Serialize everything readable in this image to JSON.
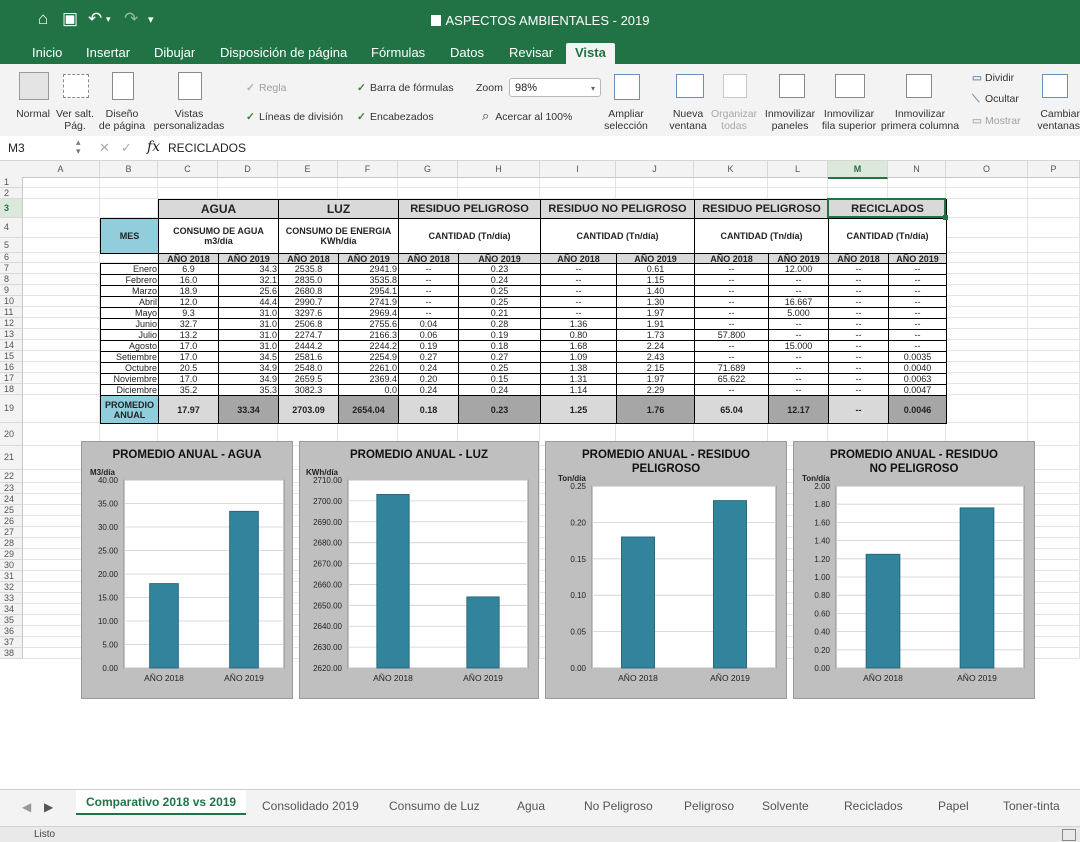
{
  "window": {
    "title": "ASPECTOS AMBIENTALES - 2019"
  },
  "ribbon_tabs": [
    "Inicio",
    "Insertar",
    "Dibujar",
    "Disposición de página",
    "Fórmulas",
    "Datos",
    "Revisar",
    "Vista"
  ],
  "active_tab": "Vista",
  "ribbon": {
    "normal": "Normal",
    "ver_salt_1": "Ver salt.",
    "ver_salt_2": "Pág.",
    "diseno_1": "Diseño",
    "diseno_2": "de página",
    "vistas_1": "Vistas",
    "vistas_2": "personalizadas",
    "regla": "Regla",
    "lineas": "Líneas de división",
    "barra": "Barra de fórmulas",
    "encabezados": "Encabezados",
    "zoom_label": "Zoom",
    "zoom_value": "98%",
    "acercar": "Acercar al 100%",
    "ampliar_1": "Ampliar",
    "ampliar_2": "selección",
    "nueva_1": "Nueva",
    "nueva_2": "ventana",
    "organizar_1": "Organizar",
    "organizar_2": "todas",
    "inm_paneles_1": "Inmovilizar",
    "inm_paneles_2": "paneles",
    "inm_fila_1": "Inmovilizar",
    "inm_fila_2": "fila superior",
    "inm_col_1": "Inmovilizar",
    "inm_col_2": "primera columna",
    "dividir": "Dividir",
    "ocultar": "Ocultar",
    "mostrar": "Mostrar",
    "cambiar_1": "Cambiar",
    "cambiar_2": "ventanas"
  },
  "formula_bar": {
    "cell_ref": "M3",
    "fx": "fx",
    "content": "RECICLADOS"
  },
  "columns": [
    "A",
    "B",
    "C",
    "D",
    "E",
    "F",
    "G",
    "H",
    "I",
    "J",
    "K",
    "L",
    "M",
    "N",
    "O",
    "P"
  ],
  "rows": [
    "1",
    "2",
    "3",
    "4",
    "5",
    "6",
    "7",
    "8",
    "9",
    "10",
    "11",
    "12",
    "13",
    "14",
    "15",
    "16",
    "17",
    "18",
    "19",
    "20",
    "21",
    "22",
    "23",
    "24",
    "25",
    "26",
    "27",
    "28",
    "29",
    "30",
    "31",
    "32",
    "33",
    "34",
    "35",
    "36",
    "37",
    "38"
  ],
  "table": {
    "sections": [
      "AGUA",
      "LUZ",
      "RESIDUO PELIGROSO",
      "RESIDUO NO PELIGROSO",
      "RESIDUO PELIGROSO",
      "RECICLADOS"
    ],
    "mes": "MES",
    "subheaders": [
      "CONSUMO DE AGUA m3/día",
      "CONSUMO DE ENERGIA KWh/día",
      "CANTIDAD (Tn/día)",
      "CANTIDAD (Tn/día)",
      "CANTIDAD (Tn/día)",
      "CANTIDAD (Tn/día)"
    ],
    "years": [
      "AÑO 2018",
      "AÑO 2019"
    ],
    "months": [
      "Enero",
      "Febrero",
      "Marzo",
      "Abril",
      "Mayo",
      "Junio",
      "Julio",
      "Agosto",
      "Setiembre",
      "Octubre",
      "Noviembre",
      "Diciembre"
    ],
    "data": [
      [
        "6.9",
        "34.3",
        "2535.8",
        "2941.9",
        "--",
        "0.23",
        "--",
        "0.61",
        "--",
        "12.000",
        "--",
        "--"
      ],
      [
        "16.0",
        "32.1",
        "2835.0",
        "3535.8",
        "--",
        "0.24",
        "--",
        "1.15",
        "--",
        "--",
        "--",
        "--"
      ],
      [
        "18.9",
        "25.6",
        "2680.8",
        "2954.1",
        "--",
        "0.25",
        "--",
        "1.40",
        "--",
        "--",
        "--",
        "--"
      ],
      [
        "12.0",
        "44.4",
        "2990.7",
        "2741.9",
        "--",
        "0.25",
        "--",
        "1.30",
        "--",
        "16.667",
        "--",
        "--"
      ],
      [
        "9.3",
        "31.0",
        "3297.6",
        "2969.4",
        "--",
        "0.21",
        "--",
        "1.97",
        "--",
        "5.000",
        "--",
        "--"
      ],
      [
        "32.7",
        "31.0",
        "2506.8",
        "2755.6",
        "0.04",
        "0.28",
        "1.36",
        "1.91",
        "--",
        "--",
        "--",
        "--"
      ],
      [
        "13.2",
        "31.0",
        "2274.7",
        "2166.3",
        "0.06",
        "0.19",
        "0.80",
        "1.73",
        "57.800",
        "--",
        "--",
        "--"
      ],
      [
        "17.0",
        "31.0",
        "2444.2",
        "2244.2",
        "0.19",
        "0.18",
        "1.68",
        "2.24",
        "--",
        "15.000",
        "--",
        "--"
      ],
      [
        "17.0",
        "34.5",
        "2581.6",
        "2254.9",
        "0.27",
        "0.27",
        "1.09",
        "2.43",
        "--",
        "--",
        "--",
        "0.0035"
      ],
      [
        "20.5",
        "34.9",
        "2548.0",
        "2261.0",
        "0.24",
        "0.25",
        "1.38",
        "2.15",
        "71.689",
        "--",
        "--",
        "0.0040"
      ],
      [
        "17.0",
        "34.9",
        "2659.5",
        "2369.4",
        "0.20",
        "0.15",
        "1.31",
        "1.97",
        "65.622",
        "--",
        "--",
        "0.0063"
      ],
      [
        "35.2",
        "35.3",
        "3082.3",
        "0.0",
        "0.24",
        "0.24",
        "1.14",
        "2.29",
        "--",
        "--",
        "--",
        "0.0047"
      ]
    ],
    "promedio_label": "PROMEDIO ANUAL",
    "promedio": [
      "17.97",
      "33.34",
      "2703.09",
      "2654.04",
      "0.18",
      "0.23",
      "1.25",
      "1.76",
      "65.04",
      "12.17",
      "--",
      "0.0046"
    ]
  },
  "chart_data": [
    {
      "type": "bar",
      "title": "PROMEDIO ANUAL - AGUA",
      "ylabel": "M3/día",
      "categories": [
        "AÑO 2018",
        "AÑO 2019"
      ],
      "values": [
        17.97,
        33.34
      ],
      "ylim": [
        0,
        40
      ],
      "yticks": [
        "0.00",
        "5.00",
        "10.00",
        "15.00",
        "20.00",
        "25.00",
        "30.00",
        "35.00",
        "40.00"
      ],
      "color": "#31849b",
      "grid": true
    },
    {
      "type": "bar",
      "title": "PROMEDIO ANUAL - LUZ",
      "ylabel": "KWh/día",
      "categories": [
        "AÑO 2018",
        "AÑO 2019"
      ],
      "values": [
        2703.09,
        2654.04
      ],
      "ylim": [
        2620,
        2710
      ],
      "yticks": [
        "2620.00",
        "2630.00",
        "2640.00",
        "2650.00",
        "2660.00",
        "2670.00",
        "2680.00",
        "2690.00",
        "2700.00",
        "2710.00"
      ],
      "color": "#31849b",
      "grid": true
    },
    {
      "type": "bar",
      "title": "PROMEDIO ANUAL - RESIDUO PELIGROSO",
      "ylabel": "Ton/día",
      "categories": [
        "AÑO 2018",
        "AÑO 2019"
      ],
      "values": [
        0.18,
        0.23
      ],
      "ylim": [
        0,
        0.25
      ],
      "yticks": [
        "0.00",
        "0.05",
        "0.10",
        "0.15",
        "0.20",
        "0.25"
      ],
      "color": "#31849b",
      "grid": true
    },
    {
      "type": "bar",
      "title": "PROMEDIO ANUAL - RESIDUO NO PELIGROSO",
      "ylabel": "Ton/día",
      "categories": [
        "AÑO 2018",
        "AÑO 2019"
      ],
      "values": [
        1.25,
        1.76
      ],
      "ylim": [
        0,
        2
      ],
      "yticks": [
        "0.00",
        "0.20",
        "0.40",
        "0.60",
        "0.80",
        "1.00",
        "1.20",
        "1.40",
        "1.60",
        "1.80",
        "2.00"
      ],
      "color": "#31849b",
      "grid": true
    }
  ],
  "sheet_tabs": [
    "Comparativo 2018 vs 2019",
    "Consolidado 2019",
    "Consumo de Luz",
    "Agua",
    "No Peligroso",
    "Peligroso",
    "Solvente",
    "Reciclados",
    "Papel",
    "Toner-tinta"
  ],
  "active_sheet": "Comparativo 2018 vs 2019",
  "status": "Listo",
  "colors": {
    "excel_green": "#217346",
    "bar": "#31849b",
    "mes_fill": "#92cddc",
    "header_fill": "#d9d9d9",
    "promedio_fill": "#a6a6a6",
    "chart_bg": "#bfbfbf"
  }
}
